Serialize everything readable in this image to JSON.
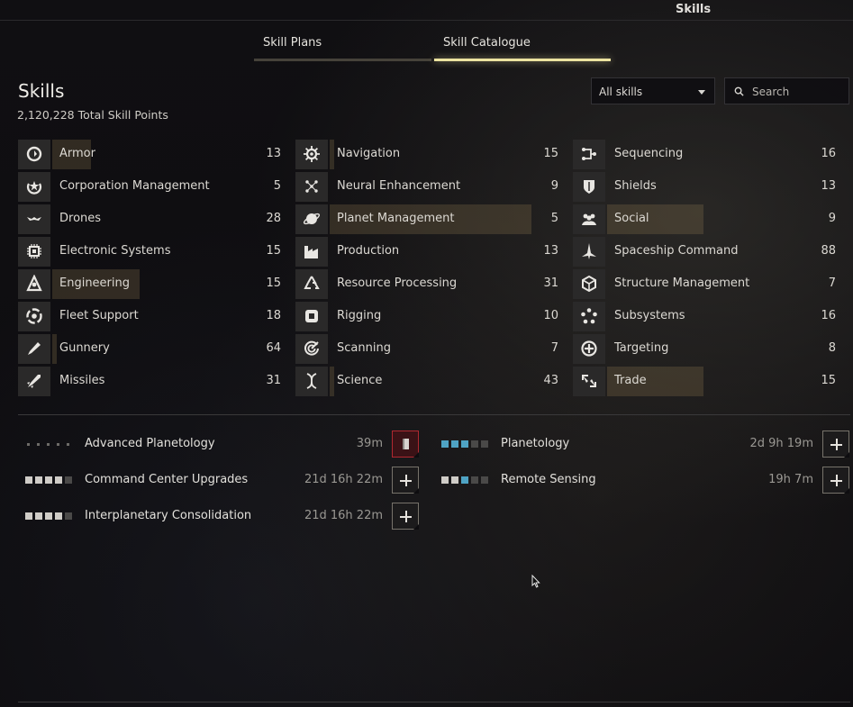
{
  "window": {
    "title": "Skills"
  },
  "tabs": [
    {
      "label": "Skill Plans",
      "active": false
    },
    {
      "label": "Skill Catalogue",
      "active": true
    }
  ],
  "header": {
    "title": "Skills",
    "total_sp": "2,120,228",
    "total_sp_label": "Total Skill Points"
  },
  "filter": {
    "selected": "All skills"
  },
  "search": {
    "placeholder": "Search",
    "value": ""
  },
  "categories": [
    {
      "name": "Armor",
      "count": "13",
      "icon": "armor-icon"
    },
    {
      "name": "Corporation Management",
      "count": "5",
      "icon": "corporation-icon"
    },
    {
      "name": "Drones",
      "count": "28",
      "icon": "drone-icon"
    },
    {
      "name": "Electronic Systems",
      "count": "15",
      "icon": "chip-icon"
    },
    {
      "name": "Engineering",
      "count": "15",
      "icon": "engineering-icon"
    },
    {
      "name": "Fleet Support",
      "count": "18",
      "icon": "fleet-icon"
    },
    {
      "name": "Gunnery",
      "count": "64",
      "icon": "gun-icon"
    },
    {
      "name": "Missiles",
      "count": "31",
      "icon": "missile-icon"
    },
    {
      "name": "Navigation",
      "count": "15",
      "icon": "navigation-icon"
    },
    {
      "name": "Neural Enhancement",
      "count": "9",
      "icon": "neural-icon"
    },
    {
      "name": "Planet Management",
      "count": "5",
      "icon": "planet-icon"
    },
    {
      "name": "Production",
      "count": "13",
      "icon": "factory-icon"
    },
    {
      "name": "Resource Processing",
      "count": "31",
      "icon": "recycle-icon"
    },
    {
      "name": "Rigging",
      "count": "10",
      "icon": "rig-icon"
    },
    {
      "name": "Scanning",
      "count": "7",
      "icon": "scanner-icon"
    },
    {
      "name": "Science",
      "count": "43",
      "icon": "science-icon"
    },
    {
      "name": "Sequencing",
      "count": "16",
      "icon": "sequence-icon"
    },
    {
      "name": "Shields",
      "count": "13",
      "icon": "shield-icon"
    },
    {
      "name": "Social",
      "count": "9",
      "icon": "social-icon"
    },
    {
      "name": "Spaceship Command",
      "count": "88",
      "icon": "ship-icon"
    },
    {
      "name": "Structure Management",
      "count": "7",
      "icon": "structure-icon"
    },
    {
      "name": "Subsystems",
      "count": "16",
      "icon": "subsystem-icon"
    },
    {
      "name": "Targeting",
      "count": "8",
      "icon": "target-icon"
    },
    {
      "name": "Trade",
      "count": "15",
      "icon": "trade-icon"
    }
  ],
  "category_progress": [
    0.17,
    0,
    0,
    0,
    0.38,
    0,
    0.02,
    0,
    0.02,
    0,
    0.88,
    0,
    0,
    0,
    0,
    0.02,
    0,
    0,
    0.42,
    0,
    0,
    0,
    0,
    0.42
  ],
  "skills": [
    {
      "name": "Advanced Planetology",
      "time": "39m",
      "levels_trained": 0,
      "levels_queued": 0,
      "action": "remove"
    },
    {
      "name": "Command Center Upgrades",
      "time": "21d 16h 22m",
      "levels_trained": 4,
      "levels_queued": 0,
      "action": "add"
    },
    {
      "name": "Interplanetary Consolidation",
      "time": "21d 16h 22m",
      "levels_trained": 4,
      "levels_queued": 0,
      "action": "add"
    },
    {
      "name": "Planetology",
      "time": "2d 9h 19m",
      "levels_trained": 0,
      "levels_queued": 3,
      "action": "add"
    },
    {
      "name": "Remote Sensing",
      "time": "19h 7m",
      "levels_trained": 2,
      "levels_queued": 1,
      "action": "add"
    }
  ],
  "colors": {
    "accent": "#ece3a0",
    "queued": "#4fa3c4",
    "danger": "#b02830"
  }
}
